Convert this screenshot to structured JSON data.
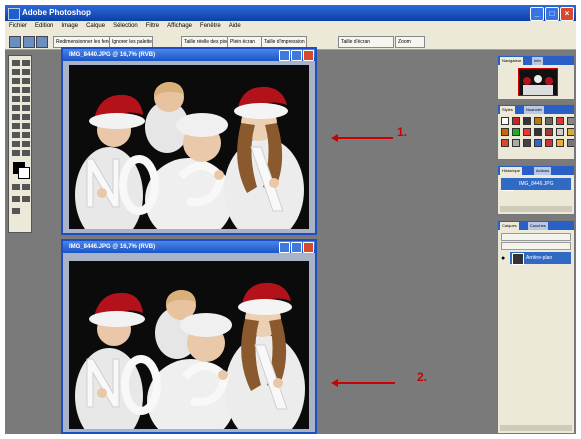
{
  "app": {
    "title": "Adobe Photoshop",
    "window_buttons": [
      "_",
      "□",
      "×"
    ]
  },
  "menu": [
    "Fichier",
    "Edition",
    "Image",
    "Calque",
    "Sélection",
    "Filtre",
    "Affichage",
    "Fenêtre",
    "Aide"
  ],
  "options_bar": {
    "chips": [
      "Redimensionner les fenêtres",
      "Ignorer les palettes",
      "Taille réelle des pixels",
      "Plein écran",
      "Taille d'impression",
      "Taille d'écran",
      "Zoom"
    ]
  },
  "documents": [
    {
      "title": "IMG_8440.JPG @ 16,7% (RVB)",
      "callout": "1."
    },
    {
      "title": "IMG_8446.JPG @ 16,7% (RVB)",
      "callout": "2."
    }
  ],
  "panels": {
    "navigator_tabs": [
      "Navigateur",
      "Info"
    ],
    "styles_tabs": [
      "Styles",
      "Nuancier"
    ],
    "history_tabs": [
      "Historique",
      "Actions"
    ],
    "history_item": "IMG_8446.JPG",
    "layers_tabs": [
      "Calques",
      "Couches"
    ],
    "layer_item": "Arrière-plan"
  },
  "colors": {
    "workspace": "#7a7a7a",
    "title_blue": "#1a55c6",
    "callout_red": "#cc0000"
  }
}
